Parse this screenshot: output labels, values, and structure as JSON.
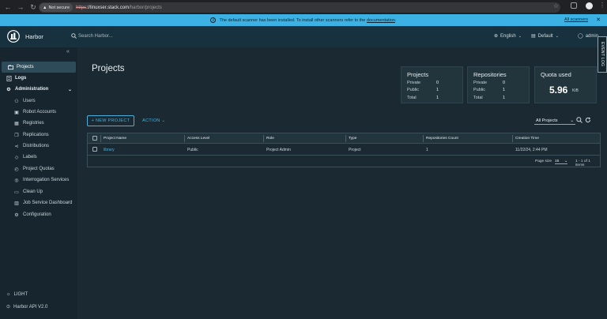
{
  "browser": {
    "not_secure": "Not secure",
    "url_scheme": "https",
    "url_host": "://linuxser.stack.com",
    "url_path": "/harbor/projects"
  },
  "banner": {
    "text": "The default scanner has been installed. To install other scanners refer to the",
    "link": "documentation",
    "all_scanners": "All scanners"
  },
  "header": {
    "app_name": "Harbor",
    "search_placeholder": "Search Harbor...",
    "language": "English",
    "theme": "Default",
    "user": "admin",
    "event_log": "EVENT LOG"
  },
  "sidebar": {
    "items": [
      {
        "label": "Projects",
        "icon": "projects-icon"
      },
      {
        "label": "Logs",
        "icon": "logs-icon"
      },
      {
        "label": "Administration",
        "icon": "administration-icon"
      },
      {
        "label": "Users",
        "icon": "users-icon"
      },
      {
        "label": "Robot Accounts",
        "icon": "robot-icon"
      },
      {
        "label": "Registries",
        "icon": "registries-icon"
      },
      {
        "label": "Replications",
        "icon": "replications-icon"
      },
      {
        "label": "Distributions",
        "icon": "distributions-icon"
      },
      {
        "label": "Labels",
        "icon": "labels-icon"
      },
      {
        "label": "Project Quotas",
        "icon": "quotas-icon"
      },
      {
        "label": "Interrogation Services",
        "icon": "interrogation-icon"
      },
      {
        "label": "Clean Up",
        "icon": "cleanup-icon"
      },
      {
        "label": "Job Service Dashboard",
        "icon": "dashboard-icon"
      },
      {
        "label": "Configuration",
        "icon": "configuration-icon"
      }
    ],
    "light_label": "LIGHT",
    "api_label": "Harbor API V2.0"
  },
  "main": {
    "title": "Projects",
    "cards": {
      "projects": {
        "title": "Projects",
        "private_label": "Private",
        "private": "0",
        "public_label": "Public",
        "public": "1",
        "total_label": "Total",
        "total": "1"
      },
      "repositories": {
        "title": "Repositories",
        "private_label": "Private",
        "private": "0",
        "public_label": "Public",
        "public": "1",
        "total_label": "Total",
        "total": "1"
      },
      "quota": {
        "title": "Quota used",
        "value": "5.96",
        "unit": "KiB"
      }
    },
    "new_project": "+ NEW PROJECT",
    "action": "ACTION",
    "filter": "All Projects",
    "table": {
      "columns": [
        "Project Name",
        "Access Level",
        "Role",
        "Type",
        "Repositories Count",
        "Creation Time"
      ],
      "rows": [
        {
          "name": "library",
          "access": "Public",
          "role": "Project Admin",
          "type": "Project",
          "repos": "1",
          "created": "11/22/24, 2:44 PM"
        }
      ],
      "page_size_label": "Page size",
      "page_size": "15",
      "range": "1 - 1 of 1 items"
    }
  },
  "colors": {
    "accent": "#49afd9",
    "banner": "#3cb2e4",
    "header": "#17323e",
    "background": "#1b2a32"
  }
}
